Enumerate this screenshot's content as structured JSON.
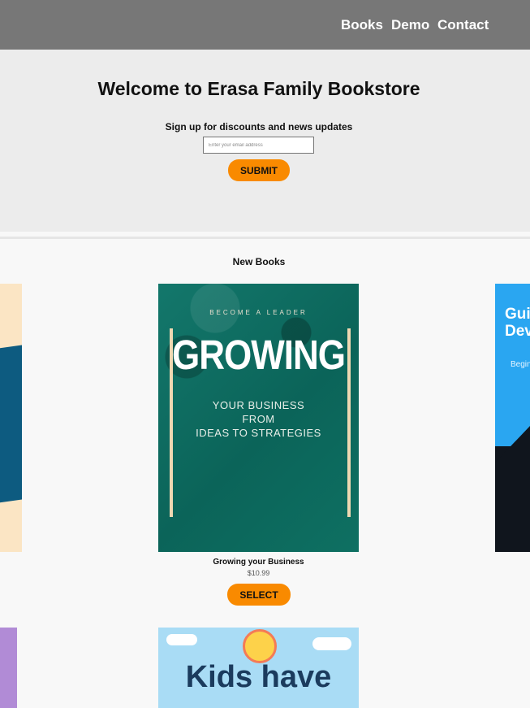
{
  "nav": {
    "books": "Books",
    "demo": "Demo",
    "contact": "Contact"
  },
  "hero": {
    "title": "Welcome to Erasa Family Bookstore",
    "signup_label": "Sign up for discounts and news updates",
    "email_placeholder": "Enter your email address",
    "submit_label": "SUBMIT"
  },
  "new_books": {
    "heading": "New Books",
    "featured": {
      "cover_tagline": "BECOME A LEADER",
      "cover_title": "GROWING",
      "cover_sub_1": "YOUR BUSINESS",
      "cover_sub_2": "FROM",
      "cover_sub_3": "IDEAS TO STRATEGIES",
      "title": "Growing your Business",
      "price": "$10.99",
      "select_label": "SELECT"
    },
    "right_cover": {
      "title_1": "Gui",
      "title_2": "Dev",
      "subtitle": "Begin"
    },
    "next_cover": {
      "title": "Kids have"
    }
  },
  "colors": {
    "topbar": "#777777",
    "accent": "#f98a00"
  }
}
